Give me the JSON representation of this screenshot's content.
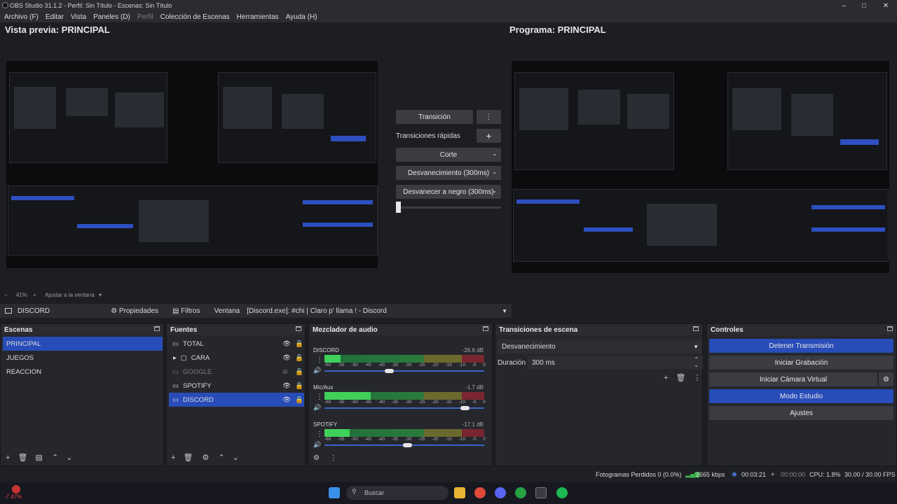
{
  "window": {
    "title": "OBS Studio 31.1.2 - Perfil: Sin Título - Escenas: Sin Título"
  },
  "menu": [
    "Archivo (F)",
    "Editar",
    "Vista",
    "Paneles (D)",
    "Perfil",
    "Colección de Escenas",
    "Herramientas",
    "Ayuda (H)"
  ],
  "preview": {
    "title": "Vista previa: PRINCIPAL",
    "zoom": "41%",
    "fit": "Ajustar a la ventana"
  },
  "program": {
    "title": "Programa: PRINCIPAL"
  },
  "transitions": {
    "button": "Transición",
    "quick_label": "Transiciones rápidas",
    "items": [
      "Corte",
      "Desvanecimiento (300ms)",
      "Desvanecer a negro (300ms)"
    ]
  },
  "source_bar": {
    "source": "DISCORD",
    "properties": "Propiedades",
    "filters": "Filtros",
    "window_label": "Ventana",
    "window_value": "[Discord.exe]: #chi | Claro p' llama ! - Discord"
  },
  "scenes": {
    "title": "Escenas",
    "items": [
      "PRINCIPAL",
      "JUEGOS",
      "REACCION"
    ]
  },
  "sources": {
    "title": "Fuentes",
    "items": [
      {
        "name": "TOTAL",
        "type": "monitor"
      },
      {
        "name": "CARA",
        "type": "folder"
      },
      {
        "name": "GOOGLE",
        "type": "monitor"
      },
      {
        "name": "SPOTIFY",
        "type": "monitor"
      },
      {
        "name": "DISCORD",
        "type": "monitor"
      }
    ]
  },
  "mixer": {
    "title": "Mezclador de audio",
    "scale": [
      "-60",
      "-55",
      "-50",
      "-45",
      "-40",
      "-35",
      "-30",
      "-25",
      "-20",
      "-15",
      "-10",
      "-5",
      "0"
    ],
    "channels": [
      {
        "name": "DISCORD",
        "db": "-26.6 dB",
        "level": 0.3
      },
      {
        "name": "Mic/Aux",
        "db": "-1.7 dB",
        "level": 0.9
      },
      {
        "name": "SPOTIFY",
        "db": "-17.1 dB",
        "level": 0.5
      }
    ]
  },
  "scene_transitions": {
    "title": "Transiciones de escena",
    "selected": "Desvanecimiento",
    "duration_label": "Duración",
    "duration_value": "300 ms"
  },
  "controls": {
    "title": "Controles",
    "buttons": [
      "Detener Transmisión",
      "Iniciar Grabación",
      "Iniciar Cámara Virtual",
      "Modo Estudio",
      "Ajustes"
    ]
  },
  "status": {
    "dropped": "Fotogramas Perdidos 0 (0.0%)",
    "bitrate": "2665 kbps",
    "stream_time": "00:03:21",
    "rec_time": "00:00:00",
    "cpu": "CPU: 1.8%",
    "fps": "30.00 / 30.00 FPS"
  },
  "taskbar": {
    "search": "Buscar",
    "temp": "-7.47%"
  }
}
